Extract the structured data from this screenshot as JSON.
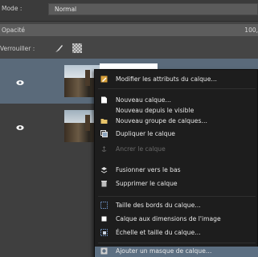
{
  "mode": {
    "label": "Mode :",
    "value": "Normal"
  },
  "opacity": {
    "label": "Opacité",
    "value": "100,"
  },
  "lock": {
    "label": "Verrouiller :"
  },
  "context_menu": {
    "items": [
      {
        "label": "Modifier les attributs du calque…",
        "icon": "edit-icon",
        "enabled": true
      },
      {
        "label": "Nouveau calque…",
        "icon": "new-layer-icon",
        "enabled": true
      },
      {
        "label": "Nouveau depuis le visible",
        "icon": "",
        "enabled": true
      },
      {
        "label": "Nouveau groupe de calques…",
        "icon": "folder-icon",
        "enabled": true
      },
      {
        "label": "Dupliquer le calque",
        "icon": "duplicate-icon",
        "enabled": true
      },
      {
        "label": "Ancrer le calque",
        "icon": "anchor-icon",
        "enabled": false
      },
      {
        "label": "Fusionner vers le bas",
        "icon": "merge-down-icon",
        "enabled": true
      },
      {
        "label": "Supprimer le calque",
        "icon": "trash-icon",
        "enabled": true
      },
      {
        "label": "Taille des bords du calque…",
        "icon": "boundary-size-icon",
        "enabled": true
      },
      {
        "label": "Calque aux dimensions de l'image",
        "icon": "layer-to-image-size-icon",
        "enabled": true
      },
      {
        "label": "Échelle et taille du calque…",
        "icon": "scale-layer-icon",
        "enabled": true
      },
      {
        "label": "Ajouter un masque de calque…",
        "icon": "add-mask-icon",
        "enabled": true
      }
    ]
  }
}
